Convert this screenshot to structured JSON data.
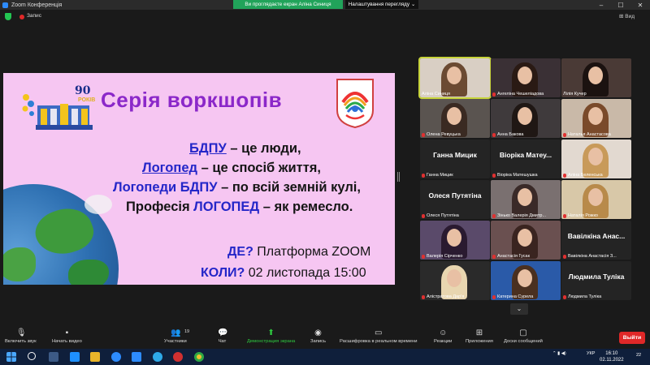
{
  "window": {
    "title": "Zoom Конференція",
    "share_banner": "Ви проглядаєте екран Аліна Синиця",
    "view_options": "Налаштування перегляду",
    "view_options_chevron": "⌄",
    "minimize": "–",
    "maximize": "☐",
    "close": "✕"
  },
  "meeting_bar": {
    "recording_label": "Запис",
    "layout_label": "⊞ Вид"
  },
  "slide": {
    "anniversary_number": "90",
    "anniversary_word": "РОКІВ",
    "title": "Серія воркшопів",
    "line1_highlight": "БДПУ",
    "line1_rest": " – це люди,",
    "line2_highlight": "Логопед",
    "line2_rest": " – це спосіб життя,",
    "line3_highlight": "Логопеди БДПУ",
    "line3_rest": " – по всій земній кулі,",
    "line4_pre": "Професія ",
    "line4_highlight": "ЛОГОПЕД",
    "line4_rest": " – як ремесло.",
    "where_label": "ДЕ?",
    "where_value": " Платформа ZOOM",
    "when_label": "КОЛИ?",
    "when_value": " 02 листопада 15:00"
  },
  "participants": [
    {
      "caption": "Аліна Синиця",
      "display": "video",
      "muted": false
    },
    {
      "caption": "Ангеліна Чешеліадова",
      "display": "video",
      "muted": true
    },
    {
      "caption": "Лілія Кучер",
      "display": "video",
      "muted": false
    },
    {
      "caption": "Олена Ревуцька",
      "display": "video",
      "muted": true
    },
    {
      "caption": "Анна Бакова",
      "display": "video",
      "muted": true
    },
    {
      "caption": "Наталья Анастасова",
      "display": "video",
      "muted": true
    },
    {
      "caption": "Ганна Мицик",
      "display": "name",
      "name_text": "Ганна Мицик",
      "muted": true
    },
    {
      "caption": "Віоріка Матешушка",
      "display": "name",
      "name_text": "Віоріка Матеу...",
      "muted": true
    },
    {
      "caption": "Аліна Беленська",
      "display": "video",
      "muted": true
    },
    {
      "caption": "Олеся Путятіна",
      "display": "name",
      "name_text": "Олеся Путятіна",
      "muted": true
    },
    {
      "caption": "Зінько Валерія Дмитр...",
      "display": "video",
      "muted": true
    },
    {
      "caption": "Наталія Рожко",
      "display": "video",
      "muted": true
    },
    {
      "caption": "Валерія Сірченко",
      "display": "video",
      "muted": true
    },
    {
      "caption": "Анастасія Гусак",
      "display": "video",
      "muted": true
    },
    {
      "caption": "Вавілкіна Анастасія З...",
      "display": "name",
      "name_text": "Вавілкіна Анас...",
      "muted": true
    },
    {
      "caption": "Алістратова Дар'я",
      "display": "video",
      "muted": true
    },
    {
      "caption": "Катерина Сурела",
      "display": "video",
      "muted": true
    },
    {
      "caption": "Людмила Туліка",
      "display": "name",
      "name_text": "Людмила Туліка",
      "muted": true
    }
  ],
  "gallery_scroll": "⌄",
  "controls": {
    "mute": "Включить звук",
    "video": "Начать видео",
    "participants": "Участники",
    "participants_count": "19",
    "chat": "Чат",
    "share": "Демонстрация экрана",
    "record": "Запись",
    "captions": "Расшифровка в реальном времени",
    "reactions": "Реакции",
    "apps": "Приложения",
    "whiteboard": "Доски сообщений",
    "leave": "Выйти"
  },
  "taskbar": {
    "time": "16:10",
    "date": "02.11.2022",
    "lang": "УКР",
    "notifications": "22"
  },
  "colors": {
    "slide_bg": "#f6c6f2",
    "title": "#8b28c9",
    "highlight": "#2426c8",
    "share_green": "#2ecc40",
    "leave_red": "#e02828"
  }
}
